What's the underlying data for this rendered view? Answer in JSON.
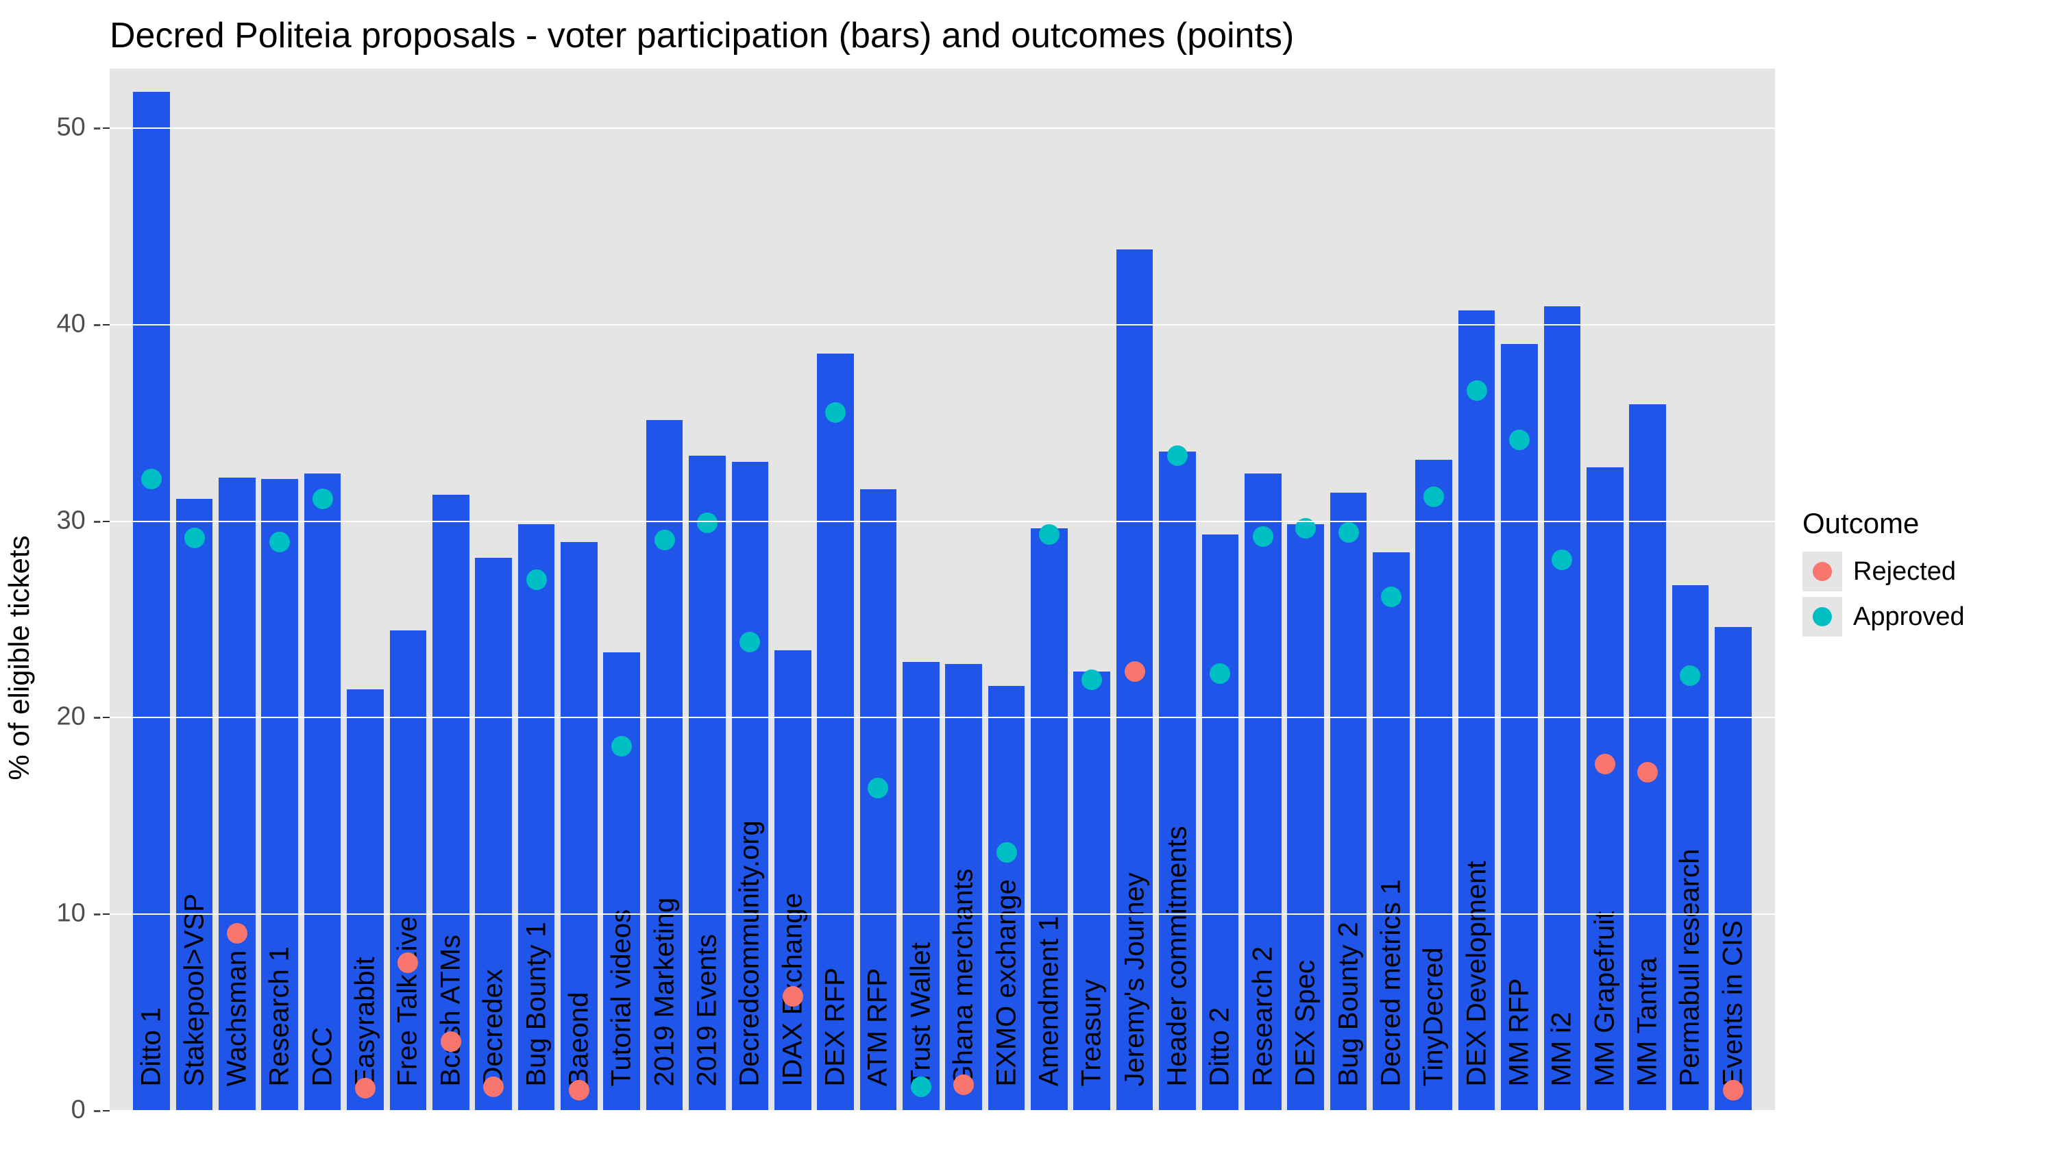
{
  "chart_data": {
    "type": "bar",
    "title": "Decred Politeia proposals - voter participation (bars) and outcomes (points)",
    "ylabel": "% of eligible tickets",
    "ylim": [
      0,
      53
    ],
    "y_ticks": [
      0,
      10,
      20,
      30,
      40,
      50
    ],
    "bar_color": "#2055ea",
    "legend": {
      "title": "Outcome",
      "items": [
        {
          "name": "Rejected",
          "color": "#f8766d"
        },
        {
          "name": "Approved",
          "color": "#00bfc4"
        }
      ]
    },
    "categories": [
      "Ditto 1",
      "Stakepool>VSP",
      "Wachsman",
      "Research 1",
      "DCC",
      "Easyrabbit",
      "Free Talk Live",
      "Bcash ATMs",
      "Decredex",
      "Bug Bounty 1",
      "Baeond",
      "Tutorial videos",
      "2019 Marketing",
      "2019 Events",
      "Decredcommunity.org",
      "IDAX Exchange",
      "DEX RFP",
      "ATM RFP",
      "Trust Wallet",
      "Ghana merchants",
      "EXMO exchange",
      "Amendment 1",
      "Treasury",
      "Jeremy's Journey",
      "Header commitments",
      "Ditto 2",
      "Research 2",
      "DEX Spec",
      "Bug Bounty 2",
      "Decred metrics 1",
      "TinyDecred",
      "DEX Development",
      "MM RFP",
      "MM i2",
      "MM Grapefruit",
      "MM Tantra",
      "Permabull research",
      "Events in CIS"
    ],
    "bars": [
      51.8,
      31.1,
      32.2,
      32.1,
      32.4,
      21.4,
      24.4,
      31.3,
      28.1,
      29.8,
      28.9,
      23.3,
      35.1,
      33.3,
      33.0,
      23.4,
      38.5,
      31.6,
      22.8,
      22.7,
      21.6,
      29.6,
      22.3,
      43.8,
      33.5,
      29.3,
      32.4,
      29.8,
      31.4,
      28.4,
      33.1,
      40.7,
      39.0,
      40.9,
      32.7,
      35.9,
      26.7,
      24.6
    ],
    "series": [
      {
        "name": "outcome_point",
        "values": [
          32.1,
          29.1,
          9.0,
          28.9,
          31.1,
          1.1,
          7.5,
          3.5,
          1.2,
          27.0,
          1.0,
          18.5,
          29.0,
          29.9,
          23.8,
          5.8,
          35.5,
          16.4,
          1.2,
          1.3,
          13.1,
          29.3,
          21.9,
          22.3,
          33.3,
          22.2,
          29.2,
          29.6,
          29.4,
          26.1,
          31.2,
          36.6,
          34.1,
          28.0,
          17.6,
          17.2,
          22.1,
          1.0
        ],
        "outcomes": [
          "Approved",
          "Approved",
          "Rejected",
          "Approved",
          "Approved",
          "Rejected",
          "Rejected",
          "Rejected",
          "Rejected",
          "Approved",
          "Rejected",
          "Approved",
          "Approved",
          "Approved",
          "Approved",
          "Rejected",
          "Approved",
          "Approved",
          "Approved",
          "Rejected",
          "Approved",
          "Approved",
          "Approved",
          "Rejected",
          "Approved",
          "Approved",
          "Approved",
          "Approved",
          "Approved",
          "Approved",
          "Approved",
          "Approved",
          "Approved",
          "Approved",
          "Rejected",
          "Rejected",
          "Approved",
          "Rejected"
        ]
      }
    ]
  }
}
